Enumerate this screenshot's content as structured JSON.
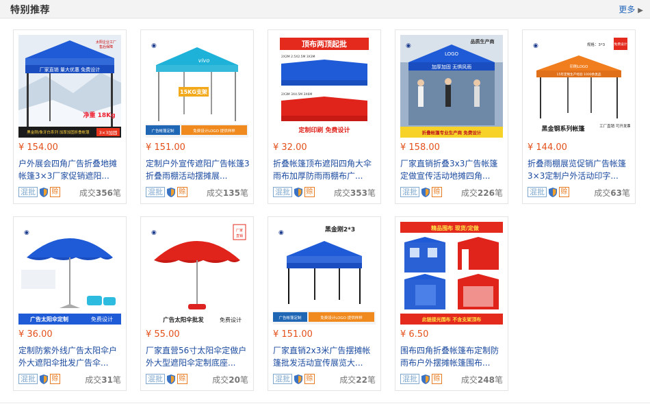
{
  "header": {
    "title": "特别推荐",
    "more_label": "更多"
  },
  "colors": {
    "accent_price": "#e4501b",
    "link_blue": "#1c4ba0",
    "tent_blue": "#1f5bd6",
    "tent_red": "#e0231b"
  },
  "products": [
    {
      "price": "¥ 154.00",
      "title": "户外展会四角广告折叠地摊帐篷3×3厂家促销遮阳...",
      "batch": "混批",
      "credit": "赊",
      "sales_prefix": "成交",
      "sales_count": "356",
      "sales_suffix": "笔",
      "image_kind": "blue-snow",
      "image_texts": [
        "太阳企业工厂",
        "售后保障",
        "厂家直销 量大优惠 免费设计",
        "净重 18Kg",
        "黑金刚/象牙白系列 加厚加固折叠帐篷",
        "3×3加固"
      ]
    },
    {
      "price": "¥ 151.00",
      "title": "定制户外宣传遮阳广告帐篷3折叠雨棚活动摆摊展...",
      "batch": "混批",
      "credit": "赊",
      "sales_prefix": "成交",
      "sales_count": "135",
      "sales_suffix": "笔",
      "image_kind": "cyan-tent",
      "image_texts": [
        "vivo",
        "15KG支架",
        "广告帐篷定制",
        "免费设计LOGO 提供样样"
      ]
    },
    {
      "price": "¥ 32.00",
      "title": "折叠帐篷顶布遮阳四角大伞雨布加厚防雨雨棚布广...",
      "batch": "混批",
      "credit": "赊",
      "sales_prefix": "成交",
      "sales_count": "353",
      "sales_suffix": "笔",
      "image_kind": "red-tops",
      "image_texts": [
        "顶布两顶起批",
        "2X2M 2.5X2.5M 3X3M",
        "2X3M 3X4.5M 3X6M",
        "定制印刷 免费设计"
      ]
    },
    {
      "price": "¥ 158.00",
      "title": "厂家直销折叠3x3广告帐篷定做宣传活动地摊四角...",
      "batch": "混批",
      "credit": "赊",
      "sales_prefix": "成交",
      "sales_count": "226",
      "sales_suffix": "笔",
      "image_kind": "people-tent",
      "image_texts": [
        "品质生产商",
        "LOGO",
        "加厚加固 无惧风雨",
        "折叠帐篷专业生产商 免费设计"
      ]
    },
    {
      "price": "¥ 144.00",
      "title": "折叠雨棚展览促销广告帐篷3×3定制户外活动印字...",
      "batch": "混批",
      "credit": "赊",
      "sales_prefix": "成交",
      "sales_count": "63",
      "sales_suffix": "笔",
      "image_kind": "orange-tent",
      "image_texts": [
        "规格：3*3",
        "免费设计",
        "印刷LOGO",
        "15年定制生产经验 1000余类品",
        "黑金钢系列帐篷",
        "工厂直销 可开发票"
      ]
    },
    {
      "price": "¥ 36.00",
      "title": "定制防紫外线广告太阳伞户外大遮阳伞批发广告伞...",
      "batch": "混批",
      "credit": "赊",
      "sales_prefix": "成交",
      "sales_count": "31",
      "sales_suffix": "笔",
      "image_kind": "blue-umbrella",
      "image_texts": [
        "广告太阳伞定制",
        "免费设计"
      ]
    },
    {
      "price": "¥ 55.00",
      "title": "厂家直营56寸太阳伞定做户外大型遮阳伞定制底座...",
      "batch": "混批",
      "credit": "赊",
      "sales_prefix": "成交",
      "sales_count": "20",
      "sales_suffix": "笔",
      "image_kind": "red-umbrella",
      "image_texts": [
        "厂家直销",
        "广告太阳伞批发",
        "免费设计"
      ]
    },
    {
      "price": "¥ 151.00",
      "title": "厂家直销2x3米广告摆摊帐篷批发活动宣传展览大...",
      "batch": "混批",
      "credit": "赊",
      "sales_prefix": "成交",
      "sales_count": "22",
      "sales_suffix": "笔",
      "image_kind": "black-frame",
      "image_texts": [
        "黑金刚2*3",
        "广告帐篷定制",
        "免费设计LOGO 提供样样"
      ]
    },
    {
      "price": "¥ 6.50",
      "title": "围布四角折叠帐篷布定制防雨布户外摆摊帐篷围布...",
      "batch": "混批",
      "credit": "赊",
      "sales_prefix": "成交",
      "sales_count": "248",
      "sales_suffix": "笔",
      "image_kind": "wall-cloth",
      "image_texts": [
        "精品围布 现货/定做",
        "此链接光围布 不含支架顶布"
      ]
    }
  ]
}
